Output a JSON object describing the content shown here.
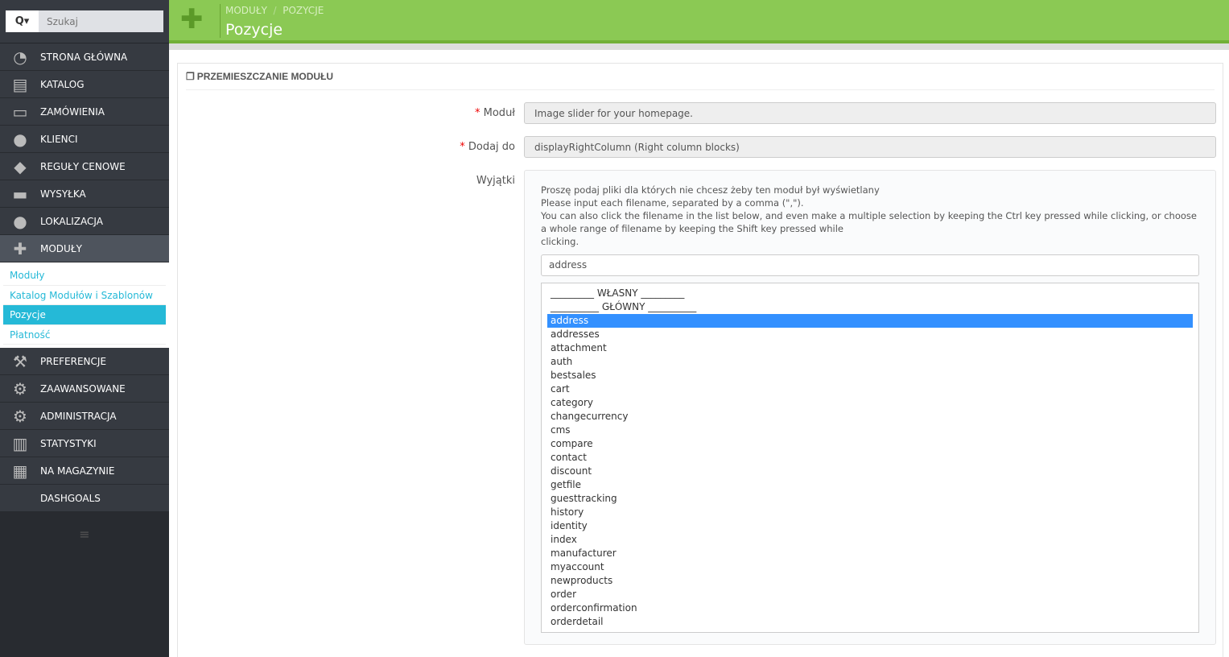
{
  "search": {
    "placeholder": "Szukaj",
    "button": "Q▾"
  },
  "menu": [
    {
      "label": "STRONA GŁÓWNA",
      "icon": "dashboard-icon",
      "glyph": "◔"
    },
    {
      "label": "KATALOG",
      "icon": "book-icon",
      "glyph": "▤"
    },
    {
      "label": "ZAMÓWIENIA",
      "icon": "credit-card-icon",
      "glyph": "▭"
    },
    {
      "label": "KLIENCI",
      "icon": "users-icon",
      "glyph": "●"
    },
    {
      "label": "REGUŁY CENOWE",
      "icon": "tags-icon",
      "glyph": "◆"
    },
    {
      "label": "WYSYŁKA",
      "icon": "truck-icon",
      "glyph": "▬"
    },
    {
      "label": "LOKALIZACJA",
      "icon": "globe-icon",
      "glyph": "●"
    },
    {
      "label": "MODUŁY",
      "icon": "puzzle-icon",
      "glyph": "✚"
    }
  ],
  "submenu": [
    "Moduły",
    "Katalog Modułów i Szablonów",
    "Pozycje",
    "Płatność"
  ],
  "menu2": [
    {
      "label": "PREFERENCJE",
      "icon": "wrench-icon",
      "glyph": "⚒"
    },
    {
      "label": "ZAAWANSOWANE",
      "icon": "cogs-icon",
      "glyph": "⚙"
    },
    {
      "label": "ADMINISTRACJA",
      "icon": "cog-icon",
      "glyph": "⚙"
    },
    {
      "label": "STATYSTYKI",
      "icon": "bar-chart-icon",
      "glyph": "▥"
    },
    {
      "label": "NA MAGAZYNIE",
      "icon": "archive-icon",
      "glyph": "▦"
    },
    {
      "label": "DASHGOALS",
      "icon": "",
      "glyph": ""
    }
  ],
  "header": {
    "breadcrumb1": "MODUŁY",
    "breadcrumb_sep": "/",
    "breadcrumb2": "POZYCJE",
    "title": "Pozycje"
  },
  "panel": {
    "title": "PRZEMIESZCZANIE MODUŁU",
    "module_label": "Moduł",
    "module_value": "Image slider for your homepage.",
    "hook_label": "Dodaj do",
    "hook_value": "displayRightColumn (Right column blocks)",
    "exceptions_label": "Wyjątki",
    "help1": "Proszę podaj pliki dla których nie chcesz żeby ten moduł był wyświetlany",
    "help2": "Please input each filename, separated by a comma (\",\").",
    "help3": "You can also click the filename in the list below, and even make a multiple selection by keeping the Ctrl key pressed while clicking, or choose a whole range of filename by keeping the Shift key pressed while",
    "help4": "clicking.",
    "exceptions_value": "address",
    "groups": [
      "_________ WŁASNY _________",
      "__________ GŁÓWNY __________"
    ],
    "files": [
      "address",
      "addresses",
      "attachment",
      "auth",
      "bestsales",
      "cart",
      "category",
      "changecurrency",
      "cms",
      "compare",
      "contact",
      "discount",
      "getfile",
      "guesttracking",
      "history",
      "identity",
      "index",
      "manufacturer",
      "myaccount",
      "newproducts",
      "order",
      "orderconfirmation",
      "orderdetail"
    ],
    "selected": "address"
  }
}
